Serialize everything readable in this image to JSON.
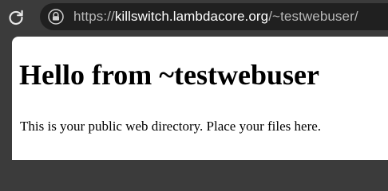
{
  "browser": {
    "toolbar": {
      "reload_icon": "reload-icon",
      "lock_icon": "lock-icon"
    },
    "address_bar": {
      "scheme": "https://",
      "host": "killswitch.lambdacore.org",
      "path": "/~testwebuser/"
    }
  },
  "page": {
    "heading": "Hello from ~testwebuser",
    "body_text": "This is your public web directory. Place your files here."
  },
  "colors": {
    "chrome_background": "#3b3b3b",
    "omnibox_background": "#202020",
    "url_muted": "#b8b8b8",
    "url_host": "#ffffff",
    "page_background": "#ffffff",
    "page_text": "#000000"
  }
}
